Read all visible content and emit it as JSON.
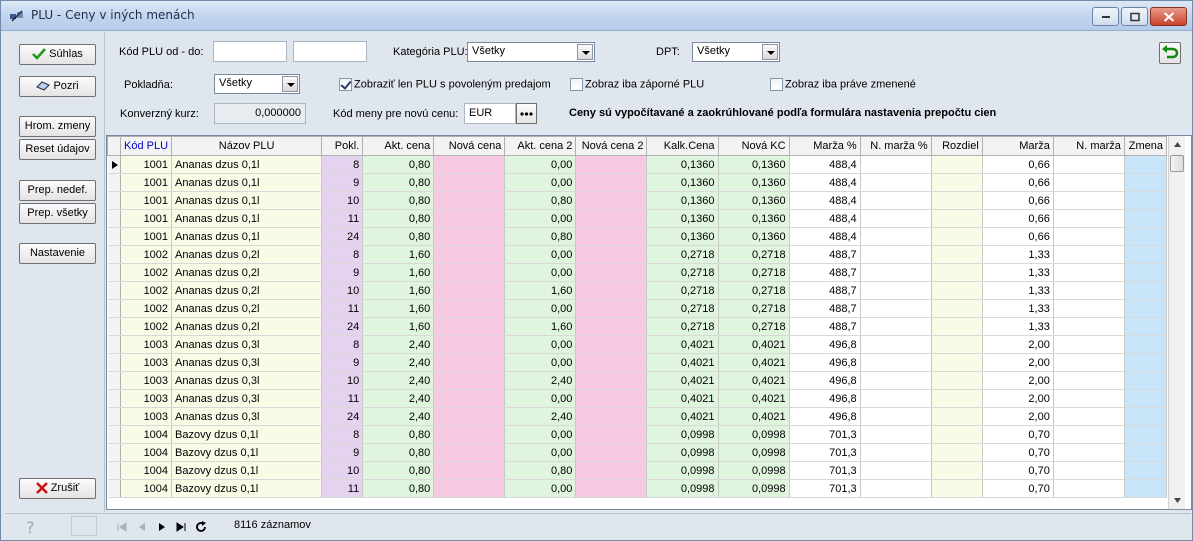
{
  "window": {
    "title": "PLU - Ceny v iných menách",
    "icon": "satellite-app-icon"
  },
  "left_buttons": {
    "suhlas": "Súhlas",
    "pozri": "Pozri",
    "hrom_zmeny": "Hrom. zmeny",
    "reset_udajov": "Reset údajov",
    "prep_nedef": "Prep. nedef.",
    "prep_vsetky": "Prep. všetky",
    "nastavenie": "Nastavenie",
    "zrusit": "Zrušiť"
  },
  "filters": {
    "kod_plu_label": "Kód PLU od - do:",
    "kod_from": "",
    "kod_to": "",
    "kategoria_label": "Kategória PLU:",
    "kategoria_value": "Všetky",
    "dpt_label": "DPT:",
    "dpt_value": "Všetky",
    "pokladna_label": "Pokladňa:",
    "pokladna_value": "Všetky",
    "chk_povolenym": "Zobraziť len PLU s povoleným predajom",
    "chk_povolenym_checked": true,
    "chk_zaporne": "Zobraz iba záporné PLU",
    "chk_zmenene": "Zobraz iba práve zmenené",
    "kurz_label": "Konverzný kurz:",
    "kurz_value": "0,000000",
    "kod_meny_label": "Kód meny pre novú cenu:",
    "kod_meny_value": "EUR",
    "info_text": "Ceny sú vypočítavané a zaokrúhlované podľa formulára nastavenia prepočtu cien"
  },
  "grid": {
    "columns": [
      "Kód PLU",
      "Názov PLU",
      "Pokl.",
      "Akt. cena",
      "Nová cena",
      "Akt. cena 2",
      "Nová cena 2",
      "Kalk.Cena",
      "Nová KC",
      "Marža %",
      "N. marža %",
      "Rozdiel",
      "Marža",
      "N. marža",
      "Zmena"
    ],
    "rows": [
      [
        "1001",
        "Ananas dzus 0,1l",
        "8",
        "0,80",
        "",
        "0,00",
        "",
        "0,1360",
        "0,1360",
        "488,4",
        "",
        "",
        "0,66",
        "",
        ""
      ],
      [
        "1001",
        "Ananas dzus 0,1l",
        "9",
        "0,80",
        "",
        "0,00",
        "",
        "0,1360",
        "0,1360",
        "488,4",
        "",
        "",
        "0,66",
        "",
        ""
      ],
      [
        "1001",
        "Ananas dzus 0,1l",
        "10",
        "0,80",
        "",
        "0,80",
        "",
        "0,1360",
        "0,1360",
        "488,4",
        "",
        "",
        "0,66",
        "",
        ""
      ],
      [
        "1001",
        "Ananas dzus 0,1l",
        "11",
        "0,80",
        "",
        "0,00",
        "",
        "0,1360",
        "0,1360",
        "488,4",
        "",
        "",
        "0,66",
        "",
        ""
      ],
      [
        "1001",
        "Ananas dzus 0,1l",
        "24",
        "0,80",
        "",
        "0,80",
        "",
        "0,1360",
        "0,1360",
        "488,4",
        "",
        "",
        "0,66",
        "",
        ""
      ],
      [
        "1002",
        "Ananas dzus 0,2l",
        "8",
        "1,60",
        "",
        "0,00",
        "",
        "0,2718",
        "0,2718",
        "488,7",
        "",
        "",
        "1,33",
        "",
        ""
      ],
      [
        "1002",
        "Ananas dzus 0,2l",
        "9",
        "1,60",
        "",
        "0,00",
        "",
        "0,2718",
        "0,2718",
        "488,7",
        "",
        "",
        "1,33",
        "",
        ""
      ],
      [
        "1002",
        "Ananas dzus 0,2l",
        "10",
        "1,60",
        "",
        "1,60",
        "",
        "0,2718",
        "0,2718",
        "488,7",
        "",
        "",
        "1,33",
        "",
        ""
      ],
      [
        "1002",
        "Ananas dzus 0,2l",
        "11",
        "1,60",
        "",
        "0,00",
        "",
        "0,2718",
        "0,2718",
        "488,7",
        "",
        "",
        "1,33",
        "",
        ""
      ],
      [
        "1002",
        "Ananas dzus 0,2l",
        "24",
        "1,60",
        "",
        "1,60",
        "",
        "0,2718",
        "0,2718",
        "488,7",
        "",
        "",
        "1,33",
        "",
        ""
      ],
      [
        "1003",
        "Ananas dzus 0,3l",
        "8",
        "2,40",
        "",
        "0,00",
        "",
        "0,4021",
        "0,4021",
        "496,8",
        "",
        "",
        "2,00",
        "",
        ""
      ],
      [
        "1003",
        "Ananas dzus 0,3l",
        "9",
        "2,40",
        "",
        "0,00",
        "",
        "0,4021",
        "0,4021",
        "496,8",
        "",
        "",
        "2,00",
        "",
        ""
      ],
      [
        "1003",
        "Ananas dzus 0,3l",
        "10",
        "2,40",
        "",
        "2,40",
        "",
        "0,4021",
        "0,4021",
        "496,8",
        "",
        "",
        "2,00",
        "",
        ""
      ],
      [
        "1003",
        "Ananas dzus 0,3l",
        "11",
        "2,40",
        "",
        "0,00",
        "",
        "0,4021",
        "0,4021",
        "496,8",
        "",
        "",
        "2,00",
        "",
        ""
      ],
      [
        "1003",
        "Ananas dzus 0,3l",
        "24",
        "2,40",
        "",
        "2,40",
        "",
        "0,4021",
        "0,4021",
        "496,8",
        "",
        "",
        "2,00",
        "",
        ""
      ],
      [
        "1004",
        "Bazovy dzus 0,1l",
        "8",
        "0,80",
        "",
        "0,00",
        "",
        "0,0998",
        "0,0998",
        "701,3",
        "",
        "",
        "0,70",
        "",
        ""
      ],
      [
        "1004",
        "Bazovy dzus 0,1l",
        "9",
        "0,80",
        "",
        "0,00",
        "",
        "0,0998",
        "0,0998",
        "701,3",
        "",
        "",
        "0,70",
        "",
        ""
      ],
      [
        "1004",
        "Bazovy dzus 0,1l",
        "10",
        "0,80",
        "",
        "0,80",
        "",
        "0,0998",
        "0,0998",
        "701,3",
        "",
        "",
        "0,70",
        "",
        ""
      ],
      [
        "1004",
        "Bazovy dzus 0,1l",
        "11",
        "0,80",
        "",
        "0,00",
        "",
        "0,0998",
        "0,0998",
        "701,3",
        "",
        "",
        "0,70",
        "",
        ""
      ]
    ]
  },
  "status": {
    "records": "8116 záznamov"
  }
}
